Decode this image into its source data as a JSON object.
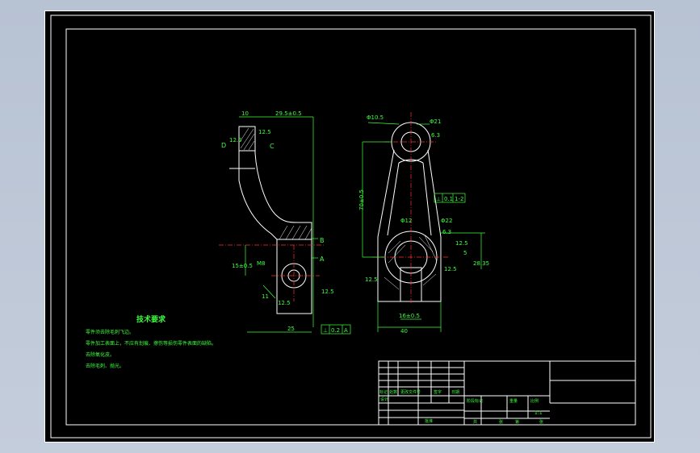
{
  "app": {
    "background_color": "#b8c3d4",
    "canvas_color": "#000000",
    "outline_color": "#ffffff",
    "dimension_color": "#3cff3c",
    "centerline_color": "#ff3030"
  },
  "side_view": {
    "dim_top_small": "10",
    "dim_top": "29.5±0.5",
    "roughness_1": "12.5",
    "dim_12_5": "12.5",
    "label_d": "D",
    "label_c": "C",
    "label_b": "B",
    "label_a": "A",
    "dim_15": "15±0.5",
    "dim_m8": "M8",
    "dim_11": "11",
    "dim_12_5b": "12.5",
    "roughness_2": "12.5",
    "dim_bottom": "25",
    "tolerance_frame": [
      "⊥",
      "0.2",
      "A"
    ]
  },
  "front_view": {
    "dim_phi_top": "Φ21",
    "dim_phi_small": "Φ10.5",
    "roughness_top": "6.3",
    "dim_height": "70±0.5",
    "tolerance_frame": [
      "⊥",
      "0.1",
      "1-2"
    ],
    "dim_phi22": "Φ22",
    "roughness_mid": "6.3",
    "dim_12_5": "12.5",
    "dim_right": "5",
    "dim_right_2": "28.35",
    "dim_phi12": "Φ12",
    "roughness_left": "12.5",
    "roughness_right": "12.5",
    "dim_width_1": "16±0.5",
    "dim_width_2": "40"
  },
  "notes": {
    "title": "技术要求",
    "lines": [
      "零件须去除毛刺飞边。",
      "零件加工表面上，不应有划痕、擦伤等损伤零件表面的缺陷。",
      "去除氧化皮。",
      "去除毛刺、抛光。"
    ]
  },
  "title_block": {
    "row_labels": [
      "标记",
      "处数",
      "更改文件号",
      "签字",
      "日期"
    ],
    "design": "设计",
    "stage_labels": [
      "阶段标记",
      "重量",
      "比例"
    ],
    "scale": "1:1",
    "approve": "批准",
    "sheets": [
      "共",
      "张",
      "第",
      "张"
    ]
  }
}
